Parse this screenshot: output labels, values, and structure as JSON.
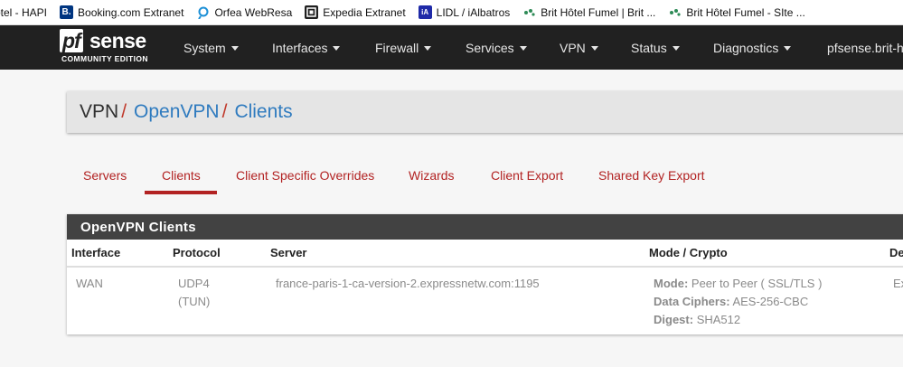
{
  "bookmarks": [
    {
      "icon": "none",
      "label": "otel - HAPI"
    },
    {
      "icon": "booking-icon",
      "glyph": "B.",
      "label": "Booking.com Extranet"
    },
    {
      "icon": "orfea-icon",
      "glyph": "◌",
      "label": "Orfea WebResa"
    },
    {
      "icon": "expedia-icon",
      "glyph": "▣",
      "label": "Expedia Extranet"
    },
    {
      "icon": "lidl-icon",
      "glyph": "iA",
      "label": "LIDL / iAlbatros"
    },
    {
      "icon": "brit-hotel-icon",
      "glyph": "✦",
      "label": "Brit Hôtel Fumel | Brit ..."
    },
    {
      "icon": "brit-hotel-icon",
      "glyph": "✦",
      "label": "Brit Hôtel Fumel - SIte ..."
    }
  ],
  "brand": {
    "logo_pf": "pf",
    "logo_sense": "sense",
    "edition": "COMMUNITY EDITION"
  },
  "nav": {
    "system": "System",
    "interfaces": "Interfaces",
    "firewall": "Firewall",
    "services": "Services",
    "vpn": "VPN",
    "status": "Status",
    "diagnostics": "Diagnostics",
    "host": "pfsense.brit-h"
  },
  "breadcrumb": {
    "root": "VPN",
    "section": "OpenVPN",
    "page": "Clients",
    "separator": "/"
  },
  "tabs": {
    "servers": "Servers",
    "clients": "Clients",
    "overrides": "Client Specific Overrides",
    "wizards": "Wizards",
    "export": "Client Export",
    "shared_key": "Shared Key Export",
    "active": "Clients"
  },
  "panel": {
    "title": "OpenVPN Clients",
    "columns": {
      "interface": "Interface",
      "protocol": "Protocol",
      "server": "Server",
      "mode_crypto": "Mode / Crypto",
      "description": "De"
    },
    "rows": [
      {
        "interface": "WAN",
        "protocol_line1": "UDP4",
        "protocol_line2": "(TUN)",
        "server": "france-paris-1-ca-version-2.expressnetw.com:1195",
        "mode_label": "Mode:",
        "mode_value": "Peer to Peer ( SSL/TLS )",
        "ciphers_label": "Data Ciphers:",
        "ciphers_value": "AES-256-CBC",
        "digest_label": "Digest:",
        "digest_value": "SHA512",
        "description": "Ex"
      }
    ]
  },
  "colors": {
    "navbar": "#212121",
    "accent_red": "#b22222",
    "link_blue": "#2f7bbf",
    "panel_header": "#424242"
  }
}
